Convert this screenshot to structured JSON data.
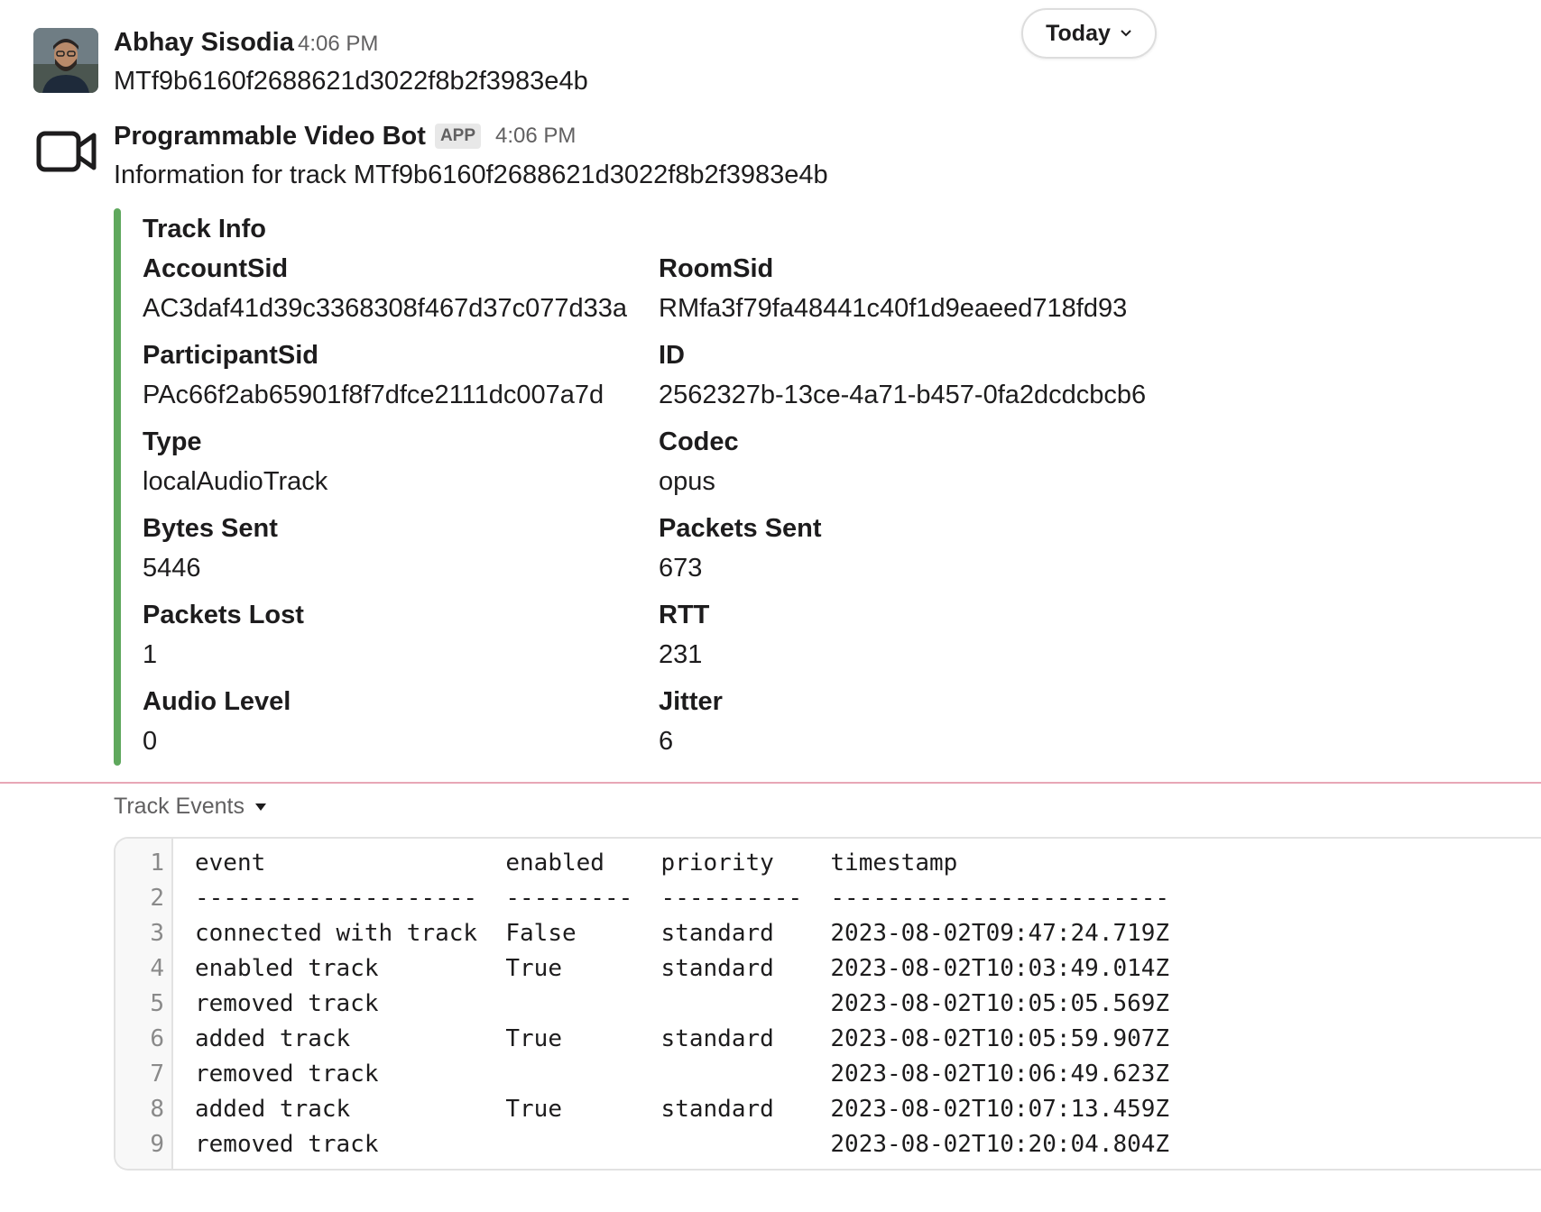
{
  "messages": [
    {
      "sender": "Abhay Sisodia",
      "time": "4:06 PM",
      "text": "MTf9b6160f2688621d3022f8b2f3983e4b",
      "avatar_icon": "user-photo"
    },
    {
      "sender": "Programmable Video Bot",
      "badge": "APP",
      "time": "4:06 PM",
      "text": "Information for track MTf9b6160f2688621d3022f8b2f3983e4b",
      "avatar_icon": "video-camera-icon"
    }
  ],
  "date_pill": {
    "label": "Today",
    "icon": "chevron-down-icon"
  },
  "attachment": {
    "accent_color": "#5fa85d",
    "title": "Track Info",
    "fields": [
      {
        "label": "AccountSid",
        "value": "AC3daf41d39c3368308f467d37c077d33a"
      },
      {
        "label": "RoomSid",
        "value": "RMfa3f79fa48441c40f1d9eaeed718fd93"
      },
      {
        "label": "ParticipantSid",
        "value": "PAc66f2ab65901f8f7dfce2111dc007a7d"
      },
      {
        "label": "ID",
        "value": "2562327b-13ce-4a71-b457-0fa2dcdcbcb6"
      },
      {
        "label": "Type",
        "value": "localAudioTrack"
      },
      {
        "label": "Codec",
        "value": "opus"
      },
      {
        "label": "Bytes Sent",
        "value": "5446"
      },
      {
        "label": "Packets Sent",
        "value": "673"
      },
      {
        "label": "Packets Lost",
        "value": "1"
      },
      {
        "label": "RTT",
        "value": "231"
      },
      {
        "label": "Audio Level",
        "value": "0"
      },
      {
        "label": "Jitter",
        "value": "6"
      }
    ]
  },
  "divider_color": "#e8a7b6",
  "snippet": {
    "title": "Track Events",
    "toggle_icon": "triangle-down-icon",
    "lines": [
      {
        "n": "1",
        "text": "event                 enabled    priority    timestamp"
      },
      {
        "n": "2",
        "text": "--------------------  ---------  ----------  ------------------------"
      },
      {
        "n": "3",
        "text": "connected with track  False      standard    2023-08-02T09:47:24.719Z"
      },
      {
        "n": "4",
        "text": "enabled track         True       standard    2023-08-02T10:03:49.014Z"
      },
      {
        "n": "5",
        "text": "removed track                                2023-08-02T10:05:05.569Z"
      },
      {
        "n": "6",
        "text": "added track           True       standard    2023-08-02T10:05:59.907Z"
      },
      {
        "n": "7",
        "text": "removed track                                2023-08-02T10:06:49.623Z"
      },
      {
        "n": "8",
        "text": "added track           True       standard    2023-08-02T10:07:13.459Z"
      },
      {
        "n": "9",
        "text": "removed track                                2023-08-02T10:20:04.804Z"
      }
    ]
  }
}
